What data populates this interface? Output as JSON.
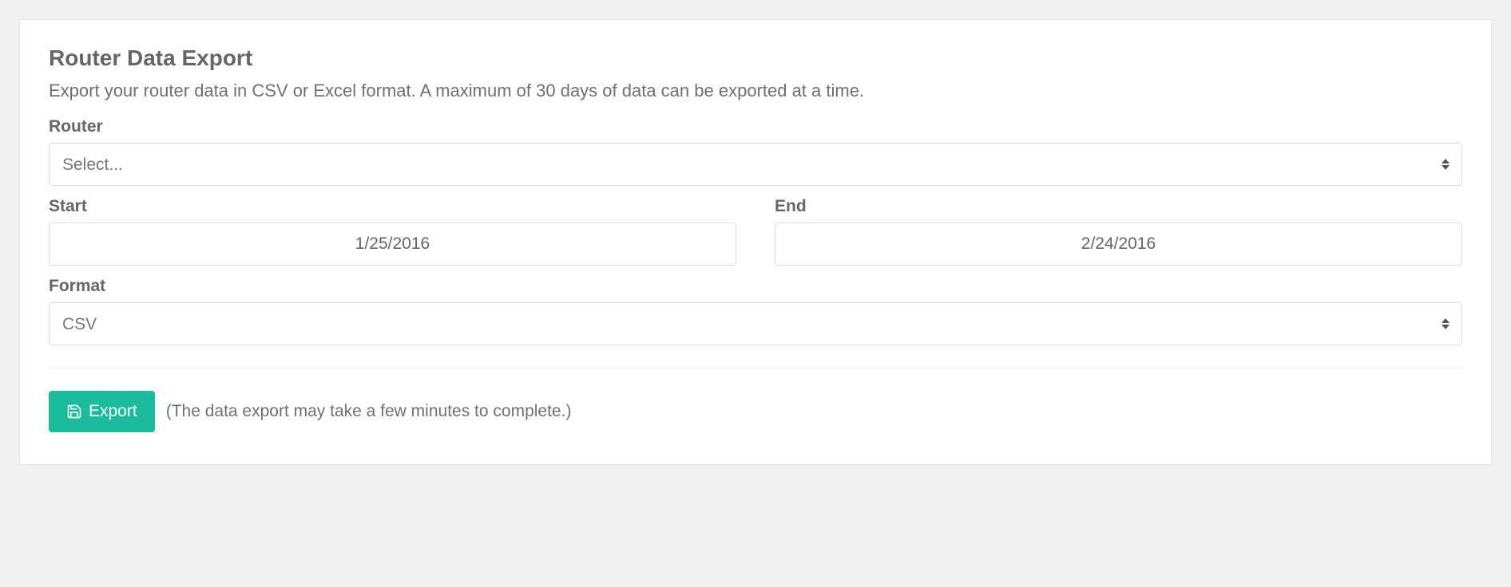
{
  "panel": {
    "title": "Router Data Export",
    "description": "Export your router data in CSV or Excel format. A maximum of 30 days of data can be exported at a time."
  },
  "form": {
    "router": {
      "label": "Router",
      "selected": "Select..."
    },
    "start": {
      "label": "Start",
      "value": "1/25/2016"
    },
    "end": {
      "label": "End",
      "value": "2/24/2016"
    },
    "format": {
      "label": "Format",
      "selected": "CSV"
    }
  },
  "actions": {
    "export_label": "Export",
    "note": "(The data export may take a few minutes to complete.)"
  },
  "colors": {
    "accent": "#1abc9c"
  }
}
